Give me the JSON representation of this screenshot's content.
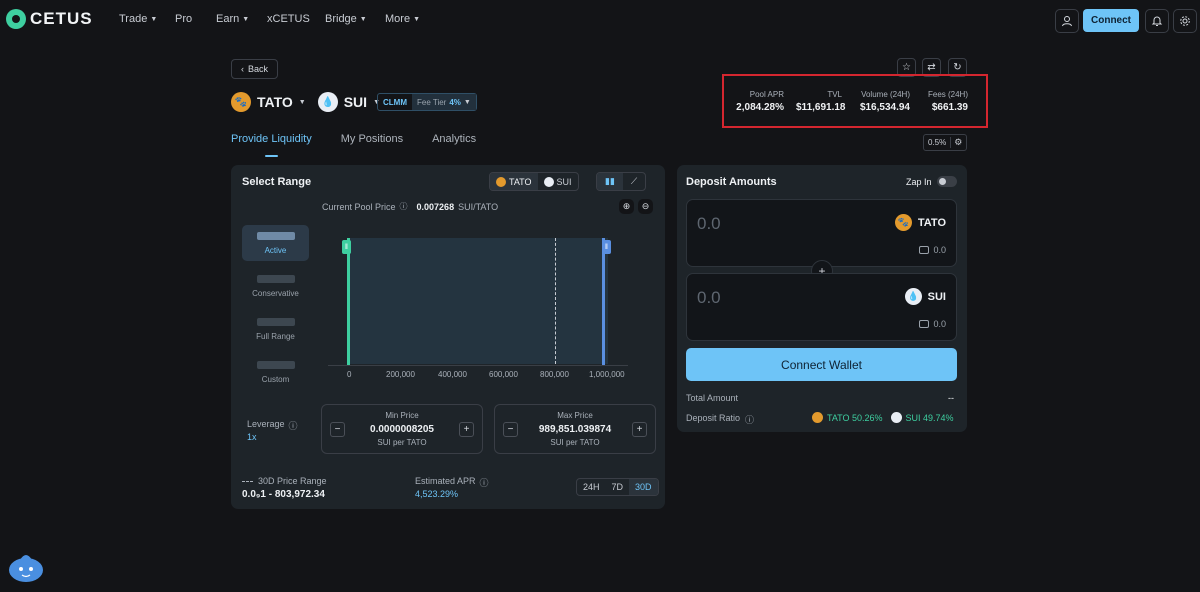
{
  "nav": {
    "logo": "CETUS",
    "items": [
      {
        "label": "Trade",
        "dropdown": true
      },
      {
        "label": "Pro",
        "dropdown": false
      },
      {
        "label": "Earn",
        "dropdown": true
      },
      {
        "label": "xCETUS",
        "dropdown": false
      },
      {
        "label": "Bridge",
        "dropdown": true
      },
      {
        "label": "More",
        "dropdown": true
      }
    ],
    "connect_label": "Connect"
  },
  "back_label": "Back",
  "pair": {
    "token_a": "TATO",
    "token_b": "SUI",
    "pool_type": "CLMM",
    "fee_tier_label": "Fee Tier",
    "fee_tier_value": "4%"
  },
  "stats": {
    "pool_apr_label": "Pool APR",
    "pool_apr": "2,084.28%",
    "tvl_label": "TVL",
    "tvl": "$11,691.18",
    "volume_label": "Volume (24H)",
    "volume": "$16,534.94",
    "fees_label": "Fees (24H)",
    "fees": "$661.39"
  },
  "tabs": [
    "Provide Liquidity",
    "My Positions",
    "Analytics"
  ],
  "slippage": "0.5%",
  "select_range": {
    "title": "Select Range",
    "toggle_a": "TATO",
    "toggle_b": "SUI",
    "current_price_label": "Current Pool Price",
    "current_price": "0.007268",
    "current_price_unit": "SUI/TATO",
    "strategies": [
      "Active",
      "Conservative",
      "Full Range",
      "Custom"
    ],
    "axis_ticks": [
      "0",
      "200,000",
      "400,000",
      "600,000",
      "800,000",
      "1,000,000"
    ],
    "leverage_label": "Leverage",
    "leverage_value": "1x",
    "min_price_label": "Min Price",
    "min_price": "0.0000008205",
    "min_price_unit": "SUI per TATO",
    "max_price_label": "Max Price",
    "max_price": "989,851.039874",
    "max_price_unit": "SUI per TATO",
    "range_30d_label": "30D Price Range",
    "range_30d_value": "0.0₉1 - 803,972.34",
    "est_apr_label": "Estimated APR",
    "est_apr": "4,523.29%",
    "periods": [
      "24H",
      "7D",
      "30D"
    ],
    "active_period": "30D"
  },
  "deposit": {
    "title": "Deposit Amounts",
    "zap_label": "Zap In",
    "amount_a": "0.0",
    "token_a": "TATO",
    "balance_a": "0.0",
    "amount_b": "0.0",
    "token_b": "SUI",
    "balance_b": "0.0",
    "connect_wallet_label": "Connect Wallet",
    "total_label": "Total Amount",
    "total_value": "--",
    "ratio_label": "Deposit Ratio",
    "ratio_a": "TATO 50.26%",
    "ratio_b": "SUI 49.74%"
  },
  "colors": {
    "accent": "#6ec4f7",
    "range_green": "#3ecfa0",
    "highlight_red": "#d4262f",
    "tato": "#e39a2d"
  }
}
